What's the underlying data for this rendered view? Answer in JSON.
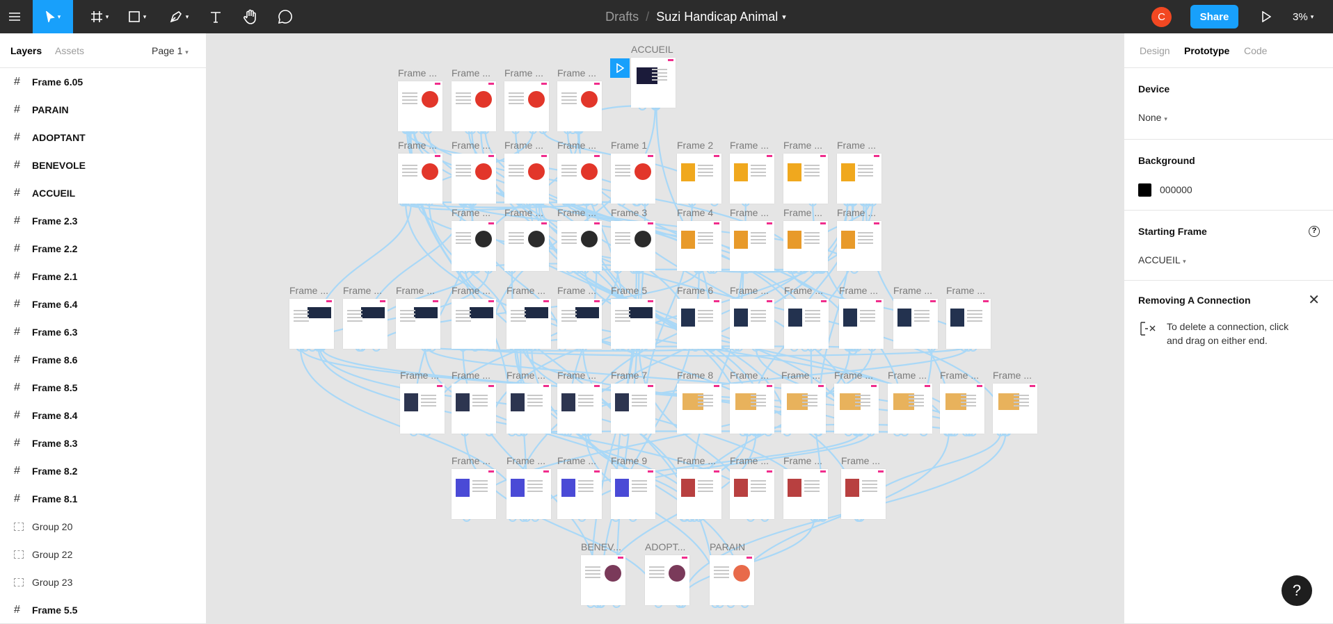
{
  "toolbar": {
    "breadcrumb_drafts": "Drafts",
    "breadcrumb_sep": "/",
    "file_name": "Suzi Handicap Animal",
    "avatar_initial": "C",
    "share_label": "Share",
    "zoom_label": "3%",
    "tools": [
      "menu-icon",
      "move-icon",
      "frame-icon",
      "shape-icon",
      "pen-icon",
      "text-icon",
      "hand-icon",
      "comment-icon"
    ]
  },
  "left_panel": {
    "tab_layers": "Layers",
    "tab_assets": "Assets",
    "page_selector": "Page 1",
    "layers": [
      {
        "label": "Frame 6.05",
        "type": "frame"
      },
      {
        "label": "PARAIN",
        "type": "frame"
      },
      {
        "label": "ADOPTANT",
        "type": "frame"
      },
      {
        "label": "BENEVOLE",
        "type": "frame"
      },
      {
        "label": "ACCUEIL",
        "type": "frame"
      },
      {
        "label": "Frame 2.3",
        "type": "frame"
      },
      {
        "label": "Frame 2.2",
        "type": "frame"
      },
      {
        "label": "Frame 2.1",
        "type": "frame"
      },
      {
        "label": "Frame 6.4",
        "type": "frame"
      },
      {
        "label": "Frame 6.3",
        "type": "frame"
      },
      {
        "label": "Frame 8.6",
        "type": "frame"
      },
      {
        "label": "Frame 8.5",
        "type": "frame"
      },
      {
        "label": "Frame 8.4",
        "type": "frame"
      },
      {
        "label": "Frame 8.3",
        "type": "frame"
      },
      {
        "label": "Frame 8.2",
        "type": "frame"
      },
      {
        "label": "Frame 8.1",
        "type": "frame"
      },
      {
        "label": "Group 20",
        "type": "group"
      },
      {
        "label": "Group 22",
        "type": "group"
      },
      {
        "label": "Group 23",
        "type": "group"
      },
      {
        "label": "Frame 5.5",
        "type": "frame"
      }
    ]
  },
  "right_panel": {
    "tabs": [
      "Design",
      "Prototype",
      "Code"
    ],
    "active_tab": "Prototype",
    "device_title": "Device",
    "device_value": "None",
    "background_title": "Background",
    "background_value": "000000",
    "background_color": "#000000",
    "starting_frame_title": "Starting Frame",
    "starting_frame_value": "ACCUEIL",
    "removing_title": "Removing A Connection",
    "removing_text": "To delete a connection, click and drag on either end."
  },
  "canvas": {
    "labels": {
      "accueil": "ACCUEIL",
      "frame_trunc": "Frame ...",
      "frame_1": "Frame 1",
      "frame_2": "Frame 2",
      "frame_3": "Frame 3",
      "frame_4": "Frame 4",
      "frame_5": "Frame 5",
      "frame_6": "Frame 6",
      "frame_7": "Frame 7",
      "frame_8": "Frame 8",
      "frame_9": "Frame 9",
      "benev": "BENEV...",
      "adopt": "ADOPT...",
      "parain": "PARAIN"
    },
    "accent_color": "#18a0fb",
    "connection_color": "#a9d8f7"
  },
  "help_label": "?"
}
